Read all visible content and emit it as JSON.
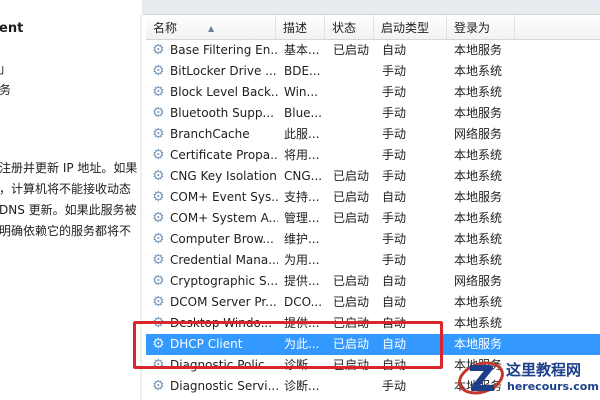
{
  "left_panel": {
    "title": "ent",
    "frag1": "」",
    "frag2": "务",
    "description_lines": [
      "注册并更新 IP 地址。如果",
      "，计算机将不能接收动态",
      "DNS 更新。如果此服务被",
      "明确依赖它的服务都将不"
    ]
  },
  "columns": {
    "name": "名称",
    "description": "描述",
    "status": "状态",
    "startup_type": "启动类型",
    "logon_as": "登录为"
  },
  "services": [
    {
      "name": "Base Filtering En...",
      "description": "基本...",
      "status": "已启动",
      "startup": "自动",
      "logon": "本地服务",
      "selected": false
    },
    {
      "name": "BitLocker Drive ...",
      "description": "BDE...",
      "status": "",
      "startup": "手动",
      "logon": "本地系统",
      "selected": false
    },
    {
      "name": "Block Level Back...",
      "description": "Win...",
      "status": "",
      "startup": "手动",
      "logon": "本地系统",
      "selected": false
    },
    {
      "name": "Bluetooth Supp...",
      "description": "Blue...",
      "status": "",
      "startup": "手动",
      "logon": "本地服务",
      "selected": false
    },
    {
      "name": "BranchCache",
      "description": "此服...",
      "status": "",
      "startup": "手动",
      "logon": "网络服务",
      "selected": false
    },
    {
      "name": "Certificate Propa...",
      "description": "将用...",
      "status": "",
      "startup": "手动",
      "logon": "本地系统",
      "selected": false
    },
    {
      "name": "CNG Key Isolation",
      "description": "CNG...",
      "status": "已启动",
      "startup": "手动",
      "logon": "本地系统",
      "selected": false
    },
    {
      "name": "COM+ Event Sys...",
      "description": "支持...",
      "status": "已启动",
      "startup": "自动",
      "logon": "本地服务",
      "selected": false
    },
    {
      "name": "COM+ System A...",
      "description": "管理...",
      "status": "已启动",
      "startup": "手动",
      "logon": "本地系统",
      "selected": false
    },
    {
      "name": "Computer Brow...",
      "description": "维护...",
      "status": "",
      "startup": "手动",
      "logon": "本地系统",
      "selected": false
    },
    {
      "name": "Credential Mana...",
      "description": "为用...",
      "status": "",
      "startup": "手动",
      "logon": "本地系统",
      "selected": false
    },
    {
      "name": "Cryptographic S...",
      "description": "提供...",
      "status": "已启动",
      "startup": "自动",
      "logon": "网络服务",
      "selected": false
    },
    {
      "name": "DCOM Server Pr...",
      "description": "DCO...",
      "status": "已启动",
      "startup": "自动",
      "logon": "本地系统",
      "selected": false
    },
    {
      "name": "Desktop Windo...",
      "description": "提供...",
      "status": "已启动",
      "startup": "自动",
      "logon": "本地系统",
      "selected": false
    },
    {
      "name": "DHCP Client",
      "description": "为此...",
      "status": "已启动",
      "startup": "自动",
      "logon": "本地服务",
      "selected": true
    },
    {
      "name": "Diagnostic Polic...",
      "description": "诊断...",
      "status": "已启动",
      "startup": "自动",
      "logon": "本地服务",
      "selected": false
    },
    {
      "name": "Diagnostic Servi...",
      "description": "诊断...",
      "status": "",
      "startup": "手动",
      "logon": "本地服务",
      "selected": false
    }
  ],
  "icons": {
    "service": "gear-icon",
    "sort": "sort-ascending-icon"
  },
  "colors": {
    "selection": "#3399ff",
    "annotation": "#d9262b",
    "watermark": "#1d3f8a"
  },
  "watermark": {
    "cn": "这里教程网",
    "en": "herecours.com"
  }
}
